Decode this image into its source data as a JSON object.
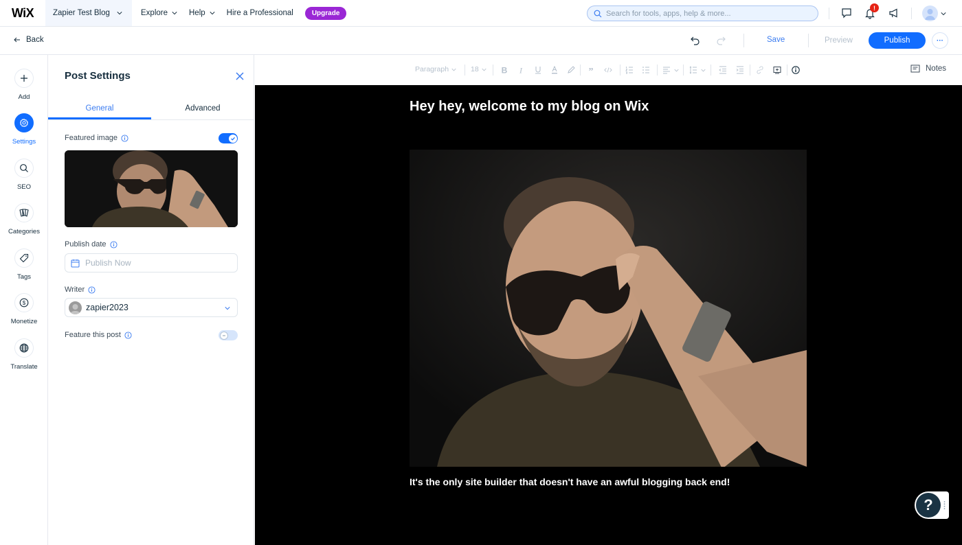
{
  "topbar": {
    "logo": "WiX",
    "site_name": "Zapier Test Blog",
    "nav": [
      {
        "label": "Explore"
      },
      {
        "label": "Help"
      },
      {
        "label": "Hire a Professional"
      }
    ],
    "upgrade_label": "Upgrade",
    "search_placeholder": "Search for tools, apps, help & more...",
    "notification_badge": "!"
  },
  "subbar": {
    "back_label": "Back",
    "save_label": "Save",
    "preview_label": "Preview",
    "publish_label": "Publish",
    "more_label": "···"
  },
  "rail": {
    "items": [
      {
        "label": "Add",
        "icon": "plus-icon",
        "active": false
      },
      {
        "label": "Settings",
        "icon": "gear-icon",
        "active": true
      },
      {
        "label": "SEO",
        "icon": "search-icon",
        "active": false
      },
      {
        "label": "Categories",
        "icon": "cards-icon",
        "active": false
      },
      {
        "label": "Tags",
        "icon": "tag-icon",
        "active": false
      },
      {
        "label": "Monetize",
        "icon": "dollar-icon",
        "active": false
      },
      {
        "label": "Translate",
        "icon": "globe-icon",
        "active": false
      }
    ]
  },
  "panel": {
    "title": "Post Settings",
    "tabs": [
      {
        "label": "General",
        "active": true
      },
      {
        "label": "Advanced",
        "active": false
      }
    ],
    "featured_image": {
      "label": "Featured image",
      "enabled": true
    },
    "publish_date": {
      "label": "Publish date",
      "placeholder": "Publish Now"
    },
    "writer": {
      "label": "Writer",
      "value": "zapier2023"
    },
    "feature_post": {
      "label": "Feature this post",
      "enabled": false
    }
  },
  "editor_toolbar": {
    "paragraph": "Paragraph",
    "font_size": "18",
    "notes_label": "Notes"
  },
  "canvas": {
    "title": "Hey hey, welcome to my blog on Wix",
    "body": "It's the only site builder that doesn't have an awful blogging back end!",
    "help_label": "?"
  },
  "colors": {
    "accent": "#116dff",
    "upgrade": "#9a27d5",
    "badge": "#e62214",
    "canvas_bg": "#000000"
  }
}
